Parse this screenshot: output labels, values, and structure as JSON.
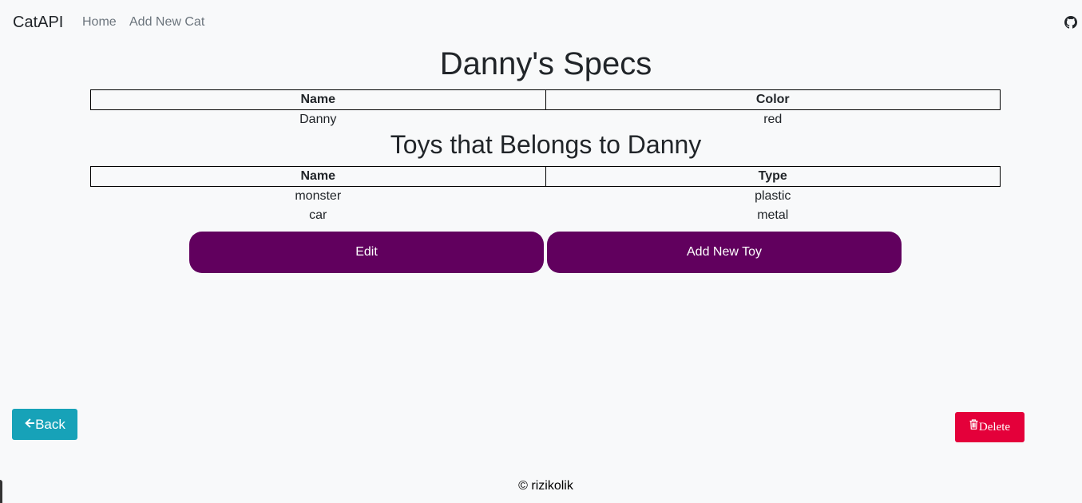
{
  "navbar": {
    "brand": "CatAPI",
    "links": [
      "Home",
      "Add New Cat"
    ],
    "github_icon": "github-icon"
  },
  "cat": {
    "title": "Danny's Specs",
    "headers": [
      "Name",
      "Color"
    ],
    "row": [
      "Danny",
      "red"
    ]
  },
  "toys": {
    "title": "Toys that Belongs to Danny",
    "headers": [
      "Name",
      "Type"
    ],
    "rows": [
      [
        "monster",
        "plastic"
      ],
      [
        "car",
        "metal"
      ]
    ]
  },
  "actions": {
    "edit_label": "Edit",
    "add_toy_label": "Add New Toy",
    "back_label": "Back",
    "back_icon": "arrow-left-icon",
    "delete_label": "Delete",
    "delete_icon": "trash-icon"
  },
  "footer": {
    "text": "© rizikolik"
  },
  "colors": {
    "background": "#f8f9fa",
    "primary_button": "#61005e",
    "back_button": "#17a2b8",
    "delete_button": "#e4003a"
  }
}
